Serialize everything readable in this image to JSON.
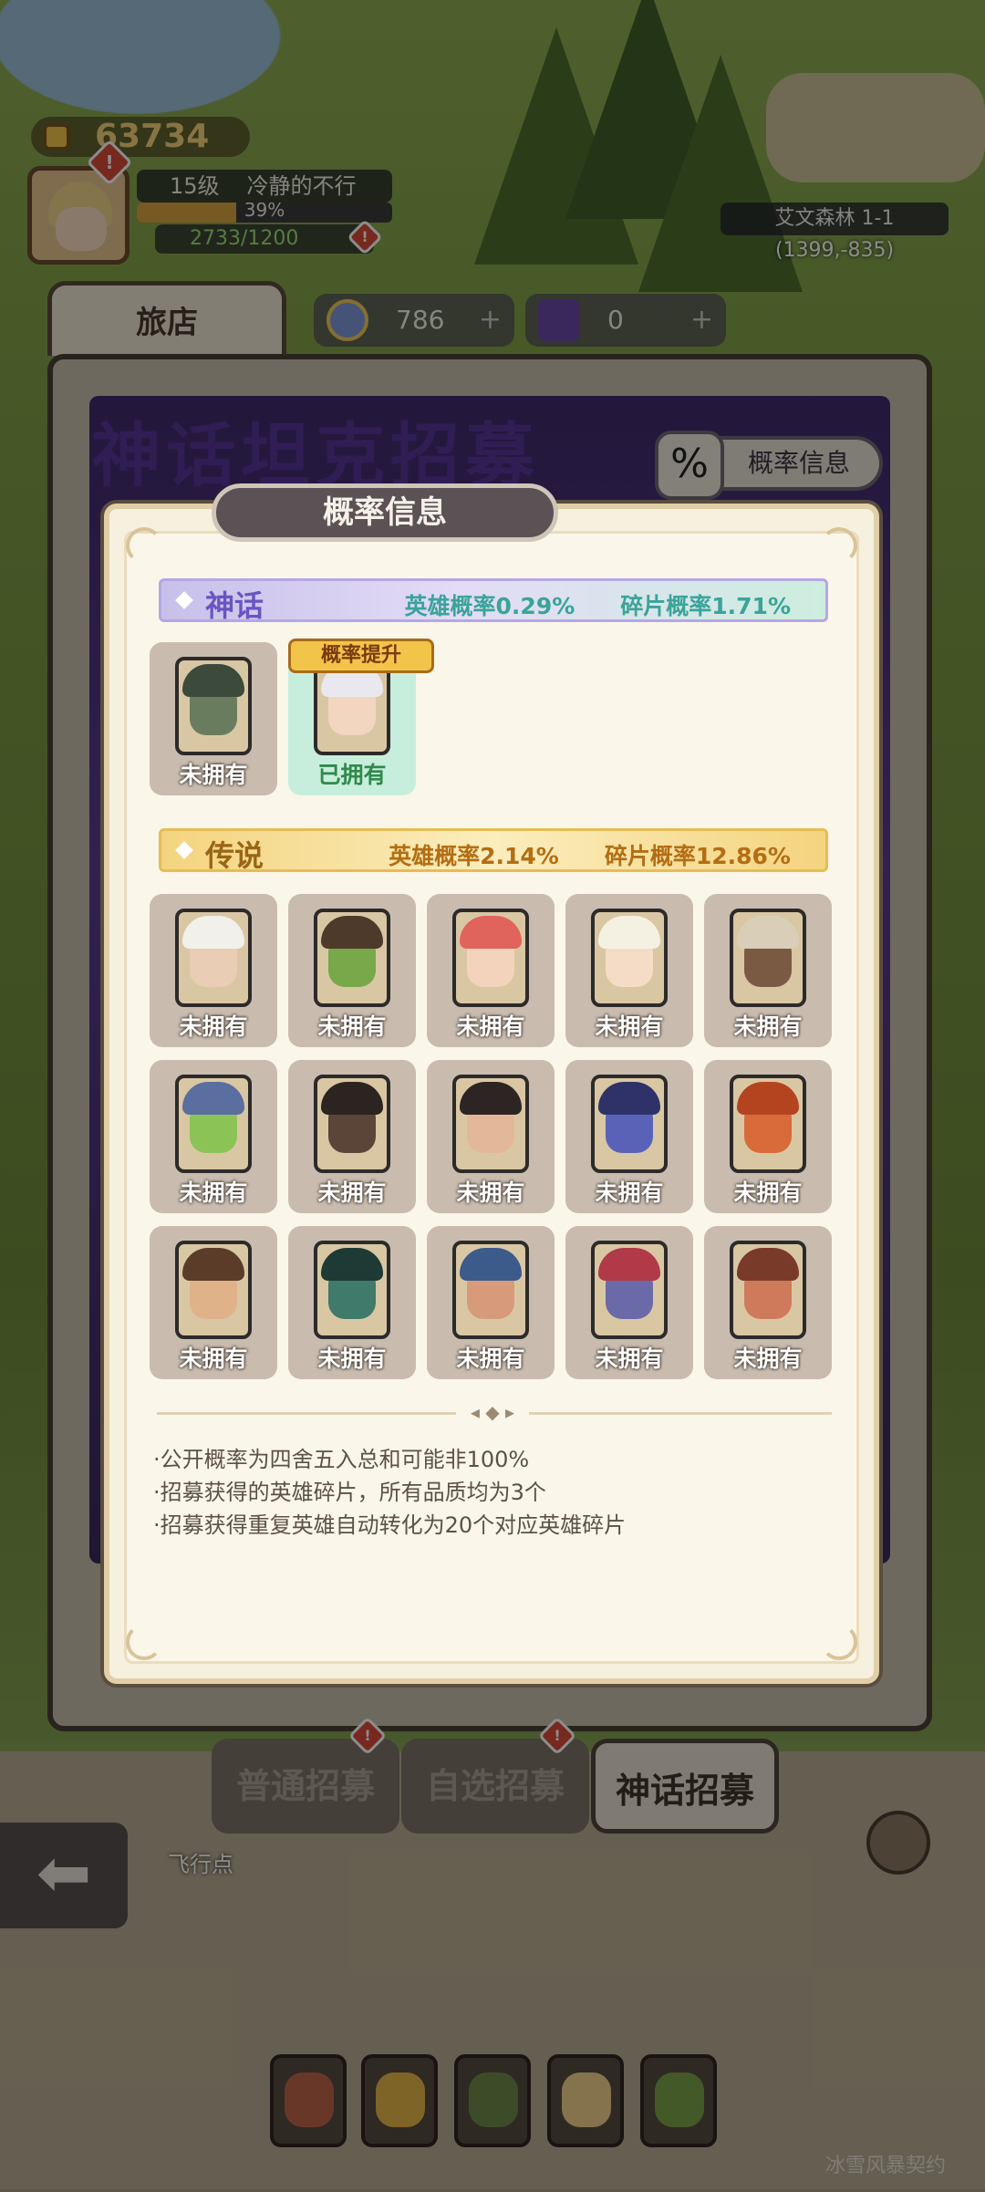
{
  "hud": {
    "gold": "63734",
    "level": "15级",
    "player_name": "冷静的不行",
    "xp_percent": "39%",
    "xp_fraction": 0.39,
    "stamina": "2733/1200",
    "location": "艾文森林 1-1",
    "coords": "(1399,-835)",
    "alert": "!"
  },
  "tabs": {
    "inn": "旅店",
    "currency1": "786",
    "currency2": "0",
    "plus": "+"
  },
  "banner": {
    "title": "神话坦克招募",
    "prob_button": "概率信息",
    "pct_icon": "%"
  },
  "dialog": {
    "title": "概率信息",
    "mythic": {
      "name": "神话",
      "hero_rate": "英雄概率0.29%",
      "shard_rate": "碎片概率1.71%",
      "up_tag": "概率提升",
      "cards": [
        {
          "status": "未拥有",
          "owned": false,
          "skin": "#6a7c5e",
          "hair": "#3b4a3a"
        },
        {
          "status": "已拥有",
          "owned": true,
          "skin": "#f2d6c0",
          "hair": "#e8e8ee"
        }
      ]
    },
    "legend": {
      "name": "传说",
      "hero_rate": "英雄概率2.14%",
      "shard_rate": "碎片概率12.86%",
      "cards": [
        {
          "status": "未拥有",
          "skin": "#e9cdb5",
          "hair": "#f1f0ea"
        },
        {
          "status": "未拥有",
          "skin": "#79a84a",
          "hair": "#4e3a2a"
        },
        {
          "status": "未拥有",
          "skin": "#f3d3bb",
          "hair": "#e1645c"
        },
        {
          "status": "未拥有",
          "skin": "#f5dcc6",
          "hair": "#f4f1e2"
        },
        {
          "status": "未拥有",
          "skin": "#7b5a44",
          "hair": "#d9cfb8"
        },
        {
          "status": "未拥有",
          "skin": "#8cc357",
          "hair": "#5b6ea0"
        },
        {
          "status": "未拥有",
          "skin": "#5b4438",
          "hair": "#2b2420"
        },
        {
          "status": "未拥有",
          "skin": "#e3b79a",
          "hair": "#2d2424"
        },
        {
          "status": "未拥有",
          "skin": "#5a62b8",
          "hair": "#2e3268"
        },
        {
          "status": "未拥有",
          "skin": "#d96a3a",
          "hair": "#b44420"
        },
        {
          "status": "未拥有",
          "skin": "#e0b289",
          "hair": "#5a3c28"
        },
        {
          "status": "未拥有",
          "skin": "#3f7a6a",
          "hair": "#1d3a34"
        },
        {
          "status": "未拥有",
          "skin": "#d79a7a",
          "hair": "#3c5a8a"
        },
        {
          "status": "未拥有",
          "skin": "#6a6aa8",
          "hair": "#b03a48"
        },
        {
          "status": "未拥有",
          "skin": "#cf7a5a",
          "hair": "#7a3a2a"
        }
      ]
    },
    "notes": [
      "·公开概率为四舍五入总和可能非100%",
      "·招募获得的英雄碎片，所有品质均为3个",
      "·招募获得重复英雄自动转化为20个对应英雄碎片"
    ]
  },
  "bottom_tabs": {
    "normal": "普通招募",
    "custom": "自选招募",
    "mythic": "神话招募"
  },
  "bottom": {
    "fly_point": "飞行点",
    "back": "⬅",
    "contract_count": "2",
    "contract": "冰雪风暴契约"
  },
  "colors": {
    "mythic_accent": "#6a54c2",
    "legend_accent": "#b36e14",
    "owned_green": "#2f8a4a",
    "dialog_bg": "#f6f0df"
  }
}
